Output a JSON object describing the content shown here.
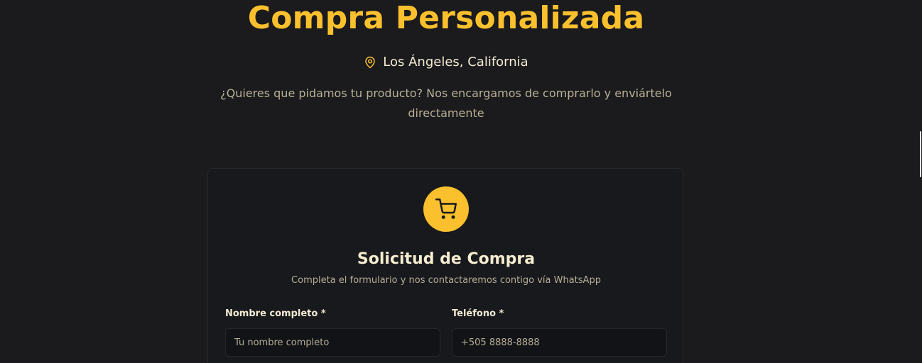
{
  "hero": {
    "title": "Compra Personalizada",
    "location_icon": "map-pin-icon",
    "location": "Los Ángeles, California",
    "subtitle": "¿Quieres que pidamos tu producto? Nos encargamos de comprarlo y enviártelo directamente"
  },
  "form": {
    "icon": "shopping-cart-icon",
    "title": "Solicitud de Compra",
    "subtitle": "Completa el formulario y nos contactaremos contigo vía WhatsApp",
    "fields": [
      {
        "label": "Nombre completo *",
        "placeholder": "Tu nombre completo",
        "value": ""
      },
      {
        "label": "Teléfono *",
        "placeholder": "+505 8888-8888",
        "value": ""
      }
    ]
  },
  "colors": {
    "accent": "#fbc02d",
    "background": "#1b1b1e",
    "card": "#17191c",
    "heading_text": "#f6ecd0",
    "muted_text": "#b9b195"
  }
}
